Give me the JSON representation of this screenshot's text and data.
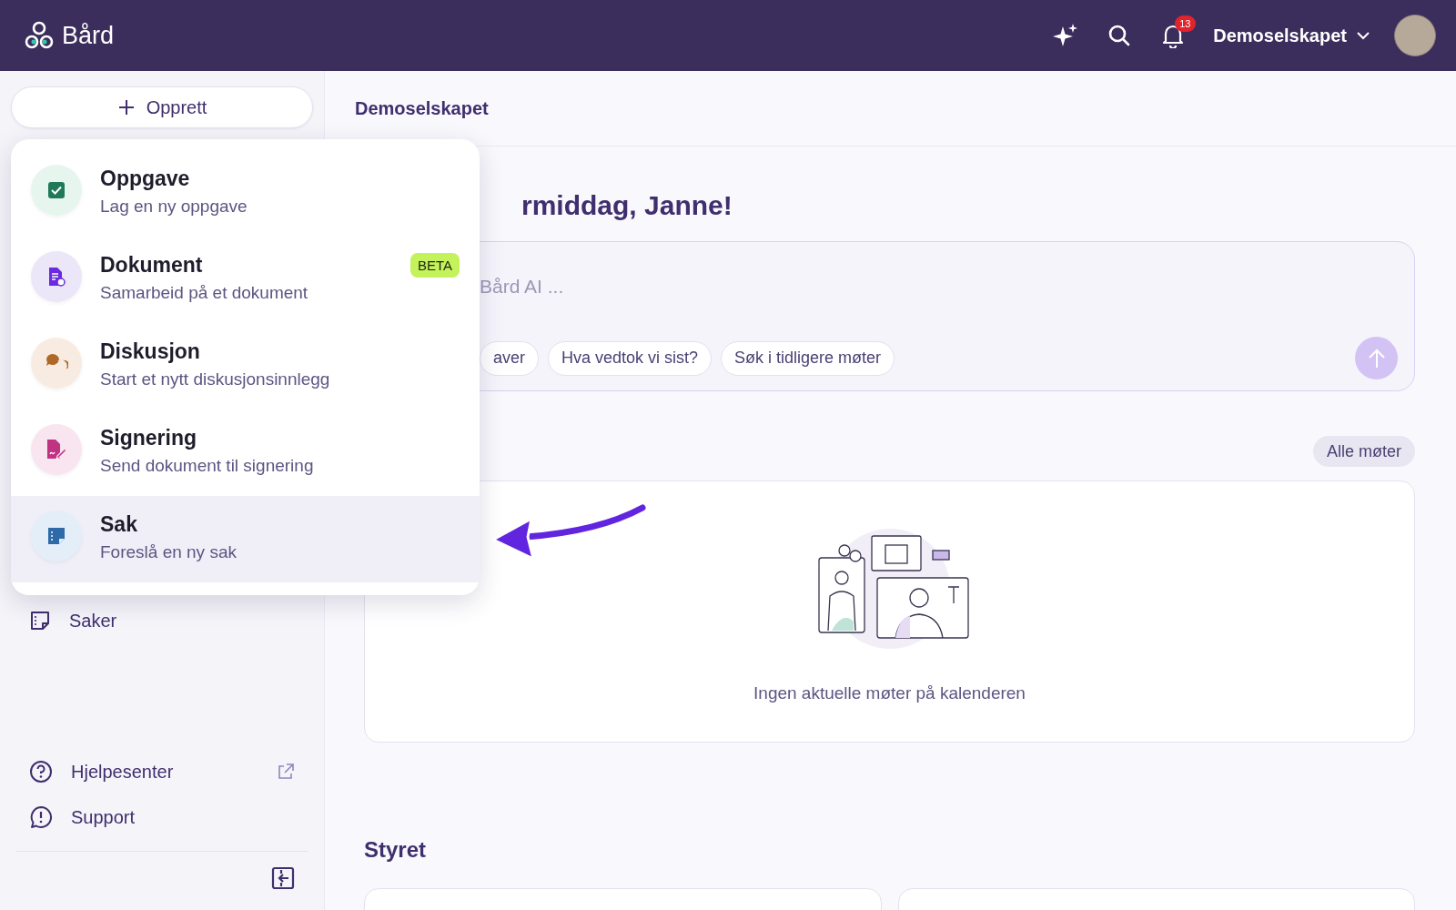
{
  "header": {
    "brand": "Bård",
    "notification_count": "13",
    "organization": "Demoselskapet"
  },
  "sidebar": {
    "create_button": "Opprett",
    "nav_items": [
      {
        "label": "Saker"
      }
    ],
    "footer_items": [
      {
        "kind": "help",
        "label": "Hjelpesenter",
        "external": true
      },
      {
        "kind": "support",
        "label": "Support",
        "external": false
      }
    ]
  },
  "create_menu": {
    "items": [
      {
        "kind": "task",
        "title": "Oppgave",
        "subtitle": "Lag en ny oppgave",
        "selected": false
      },
      {
        "kind": "document",
        "title": "Dokument",
        "subtitle": "Samarbeid på et dokument",
        "badge": "BETA",
        "selected": false
      },
      {
        "kind": "discussion",
        "title": "Diskusjon",
        "subtitle": "Start et nytt diskusjonsinnlegg",
        "selected": false
      },
      {
        "kind": "signing",
        "title": "Signering",
        "subtitle": "Send dokument til signering",
        "selected": false
      },
      {
        "kind": "case",
        "title": "Sak",
        "subtitle": "Foreslå en ny sak",
        "selected": true
      }
    ]
  },
  "main": {
    "breadcrumb": "Demoselskapet",
    "greeting": "rmiddag, Janne!",
    "ai_prompt": {
      "placeholder": "Bård AI ...",
      "suggestions": [
        "aver",
        "Hva vedtok vi sist?",
        "Søk i tidligere møter"
      ]
    },
    "meetings": {
      "all_button": "Alle møter",
      "empty_text": "Ingen aktuelle møter på kalenderen"
    },
    "board": {
      "title": "Styret"
    }
  }
}
